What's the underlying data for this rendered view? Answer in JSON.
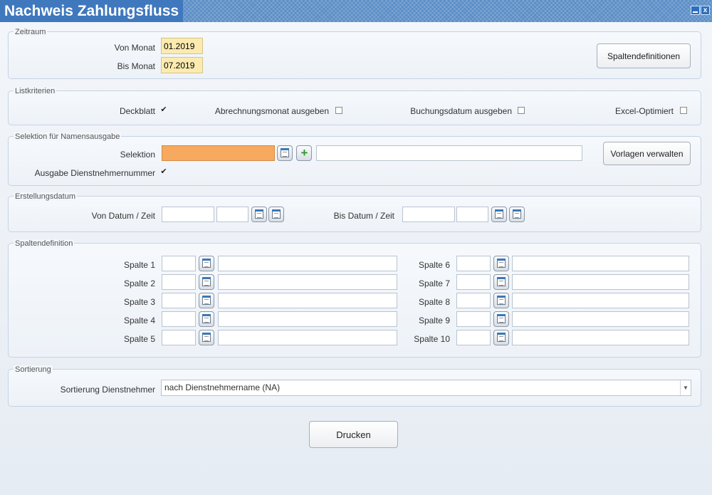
{
  "window": {
    "title": "Nachweis Zahlungsfluss"
  },
  "zeitraum": {
    "legend": "Zeitraum",
    "von_label": "Von Monat",
    "von_value": "01.2019",
    "bis_label": "Bis Monat",
    "bis_value": "07.2019",
    "spaltendef_button": "Spaltendefinitionen"
  },
  "listkriterien": {
    "legend": "Listkriterien",
    "deckblatt": "Deckblatt",
    "abrechnungsmonat": "Abrechnungsmonat ausgeben",
    "buchungsdatum": "Buchungsdatum ausgeben",
    "excel": "Excel-Optimiert"
  },
  "selektion": {
    "legend": "Selektion für Namensausgabe",
    "label": "Selektion",
    "vorlagen_button": "Vorlagen verwalten",
    "dnr_label": "Ausgabe Dienstnehmernummer"
  },
  "erstellungsdatum": {
    "legend": "Erstellungsdatum",
    "von_label": "Von Datum / Zeit",
    "bis_label": "Bis Datum / Zeit"
  },
  "spaltendefinition": {
    "legend": "Spaltendefinition",
    "spalten": [
      "Spalte 1",
      "Spalte 2",
      "Spalte 3",
      "Spalte 4",
      "Spalte 5",
      "Spalte 6",
      "Spalte 7",
      "Spalte 8",
      "Spalte 9",
      "Spalte 10"
    ]
  },
  "sortierung": {
    "legend": "Sortierung",
    "label": "Sortierung Dienstnehmer",
    "selected": "nach Dienstnehmername (NA)"
  },
  "drucken_button": "Drucken",
  "checkmark": "✔"
}
